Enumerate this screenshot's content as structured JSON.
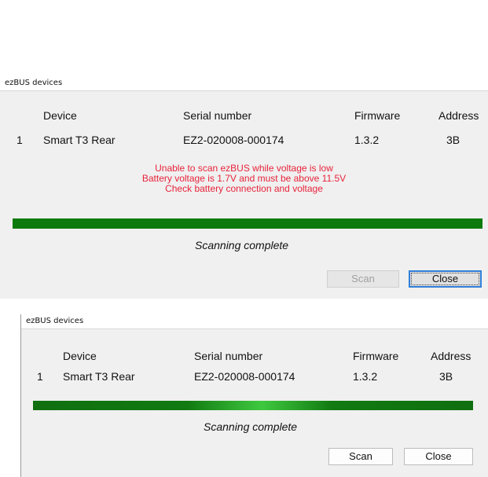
{
  "dialog1": {
    "title": "ezBUS devices",
    "headers": {
      "device": "Device",
      "serial": "Serial number",
      "firmware": "Firmware",
      "address": "Address"
    },
    "row": {
      "index": "1",
      "device": "Smart T3 Rear",
      "serial": "EZ2-020008-000174",
      "firmware": "1.3.2",
      "address": "3B"
    },
    "warnings": [
      "Unable to scan ezBUS while voltage is low",
      "Battery voltage is 1.7V and must be above 11.5V",
      "Check battery connection and voltage"
    ],
    "status": "Scanning complete",
    "scan_label": "Scan",
    "close_label": "Close"
  },
  "dialog2": {
    "title": "ezBUS devices",
    "headers": {
      "device": "Device",
      "serial": "Serial number",
      "firmware": "Firmware",
      "address": "Address"
    },
    "row": {
      "index": "1",
      "device": "Smart T3 Rear",
      "serial": "EZ2-020008-000174",
      "firmware": "1.3.2",
      "address": "3B"
    },
    "status": "Scanning complete",
    "scan_label": "Scan",
    "close_label": "Close"
  },
  "colors": {
    "progress": "#0d7a0d",
    "warning": "#e8233a",
    "focus": "#2f7ed8"
  }
}
